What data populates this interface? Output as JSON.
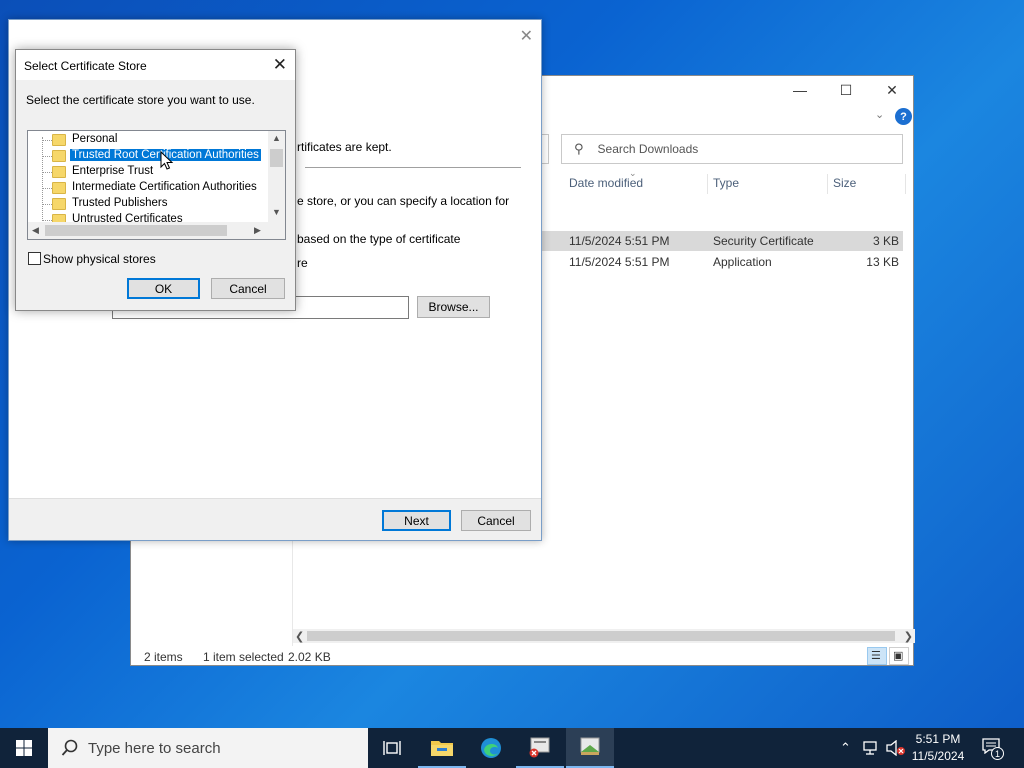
{
  "explorer": {
    "search_placeholder": "Search Downloads",
    "columns": [
      "Date modified",
      "Type",
      "Size"
    ],
    "files": [
      {
        "date": "11/5/2024 5:51 PM",
        "type": "Security Certificate",
        "size": "3 KB",
        "selected": true
      },
      {
        "date": "11/5/2024 5:51 PM",
        "type": "Application",
        "size": "13 KB",
        "selected": false
      }
    ],
    "status": {
      "items": "2 items",
      "selected": "1 item selected",
      "size": "2.02 KB"
    }
  },
  "wizard": {
    "fragments": {
      "kept": "rtificates are kept.",
      "store_or": "e store, or you can specify a location for",
      "based_on": "based on the type of certificate",
      "re": "re"
    },
    "browse_label": "Browse...",
    "next_label": "Next",
    "cancel_label": "Cancel"
  },
  "store_dialog": {
    "title": "Select Certificate Store",
    "instruction": "Select the certificate store you want to use.",
    "stores": [
      "Personal",
      "Trusted Root Certification Authorities",
      "Enterprise Trust",
      "Intermediate Certification Authorities",
      "Trusted Publishers",
      "Untrusted Certificates"
    ],
    "selected_store": "Trusted Root Certification Authorities",
    "show_physical_label": "Show physical stores",
    "show_physical_checked": false,
    "ok_label": "OK",
    "cancel_label": "Cancel"
  },
  "taskbar": {
    "search_placeholder": "Type here to search",
    "time": "5:51 PM",
    "date": "11/5/2024",
    "notification_count": "1"
  },
  "colors": {
    "accent": "#0078d7",
    "taskbar": "#10233a",
    "desktop": "#0a63d1"
  }
}
